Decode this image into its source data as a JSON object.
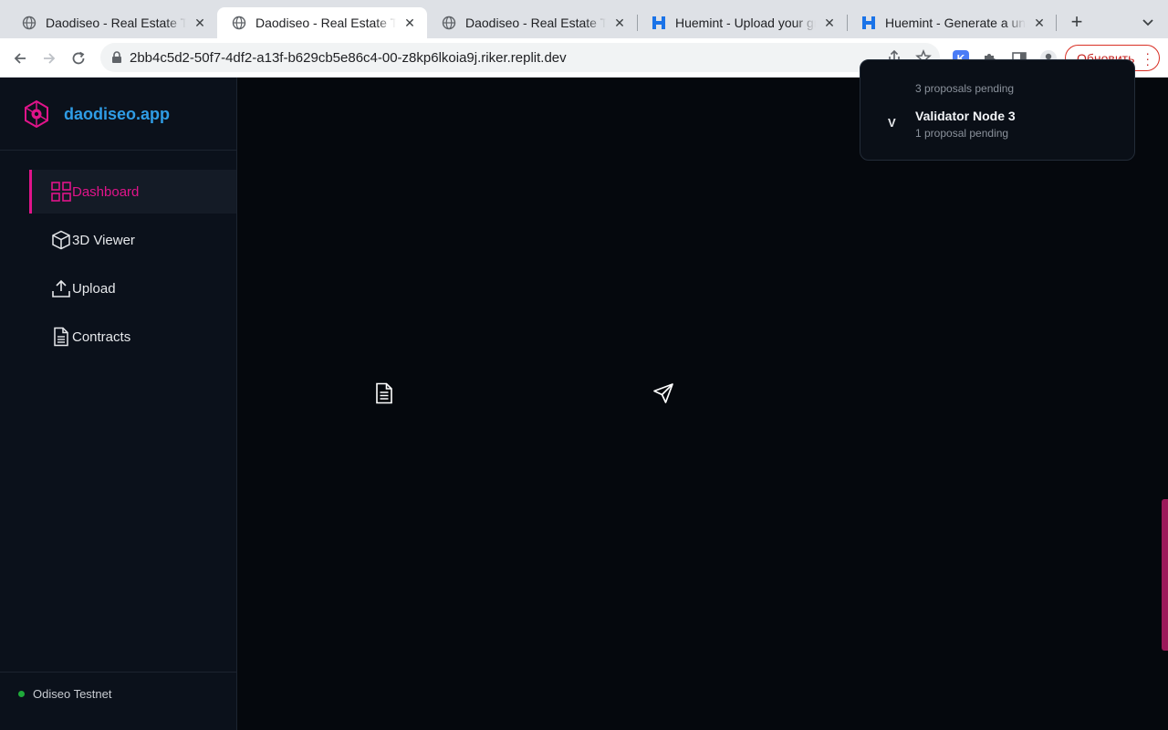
{
  "browser": {
    "tabs": [
      {
        "title": "Daodiseo - Real Estate Tokeniz",
        "favicon": "globe-icon",
        "active": false
      },
      {
        "title": "Daodiseo - Real Estate Tokeniz",
        "favicon": "globe-icon",
        "active": true
      },
      {
        "title": "Daodiseo - Real Estate Tokeniz",
        "favicon": "globe-icon",
        "active": false
      },
      {
        "title": "Huemint - Upload your graphic",
        "favicon": "huemint-icon",
        "active": false
      },
      {
        "title": "Huemint - Generate a unique c",
        "favicon": "huemint-icon",
        "active": false
      }
    ],
    "new_tab_label": "+",
    "url": "2bb4c5d2-50f7-4df2-a13f-b629cb5e86c4-00-z8kp6lkoia9j.riker.replit.dev",
    "update_label": "Обновить",
    "extension_k_label": "K",
    "colors": {
      "update": "#c5221f",
      "extension": "#4a7cf6"
    }
  },
  "sidebar": {
    "brand": "daodiseo.app",
    "items": [
      {
        "label": "Dashboard",
        "icon": "grid-icon",
        "active": true
      },
      {
        "label": "3D Viewer",
        "icon": "cube-icon",
        "active": false
      },
      {
        "label": "Upload",
        "icon": "upload-icon",
        "active": false
      },
      {
        "label": "Contracts",
        "icon": "document-icon",
        "active": false
      }
    ],
    "network": {
      "label": "Odiseo Testnet",
      "status_color": "#1faa3a"
    }
  },
  "main": {
    "icons": [
      "document-icon",
      "send-icon"
    ],
    "validators": {
      "partial_pending": "3 proposals pending",
      "items": [
        {
          "avatar": "V",
          "name": "Validator Node 3",
          "pending": "1 proposal pending"
        }
      ]
    }
  },
  "theme": {
    "accent": "#e0148a",
    "brand_blue": "#2f9de6",
    "background": "#05080d",
    "sidebar": "#0b111b"
  }
}
